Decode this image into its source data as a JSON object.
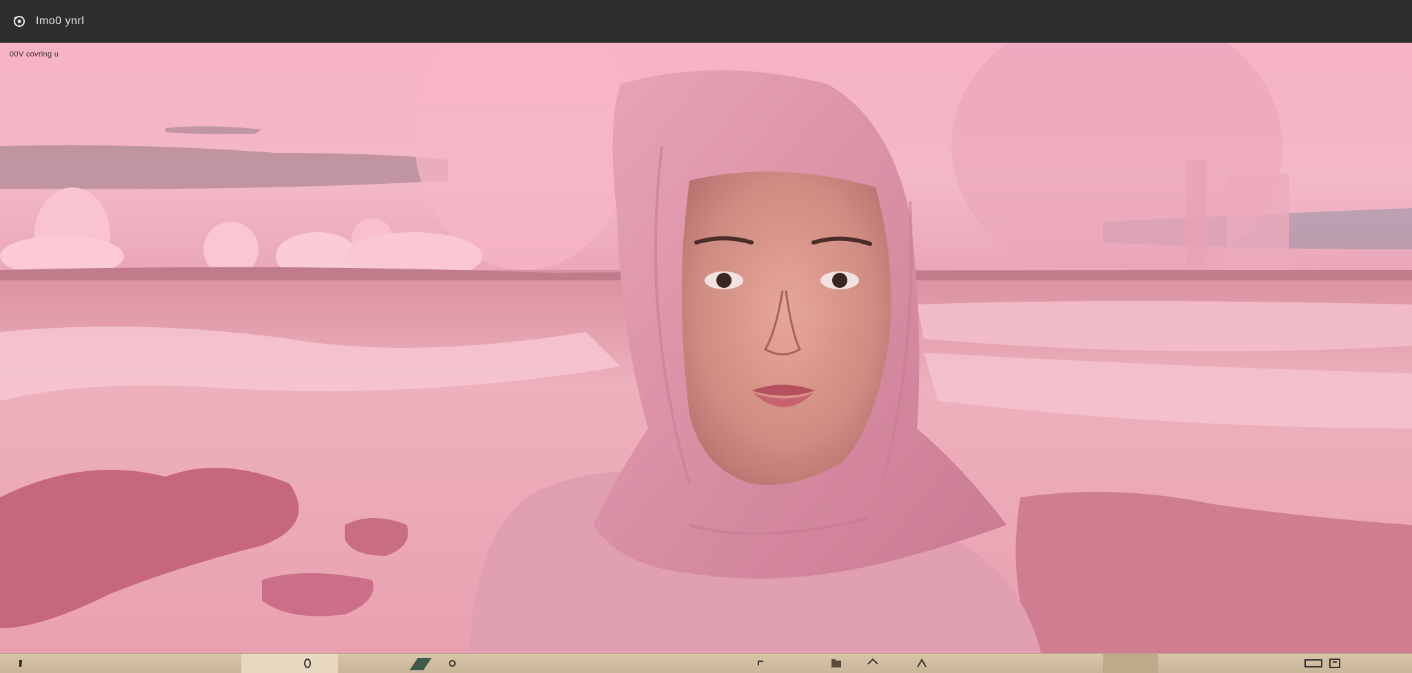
{
  "window": {
    "title": "Imo0 ynrl",
    "icon": "camera-lens-icon"
  },
  "viewer": {
    "caption": "00V covring u",
    "image_subject": "pink-desert-portrait"
  },
  "taskbar": {
    "icons": [
      "start-icon",
      "search-icon",
      "pen-icon",
      "app-icon",
      "cursor-icon",
      "folder-icon",
      "home-icon",
      "up-icon",
      "window-icon",
      "settings-icon"
    ]
  },
  "colors": {
    "titlebar": "#2d2d2d",
    "sky": "#f2a9bf",
    "ground": "#e7a3b3",
    "hijab": "#d98ea4",
    "taskbar": "#d8c6a8"
  }
}
